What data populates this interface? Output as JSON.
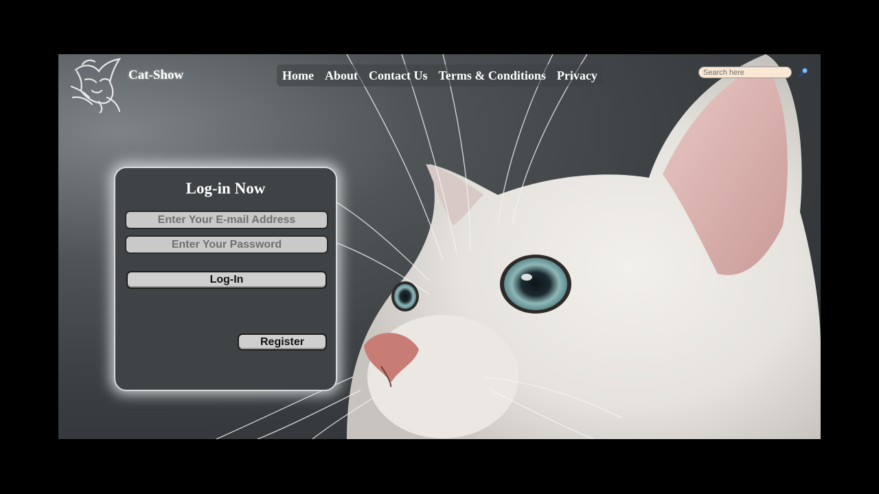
{
  "header": {
    "brand": "Cat-Show",
    "nav": [
      "Home",
      "About",
      "Contact Us",
      "Terms & Conditions",
      "Privacy"
    ],
    "search_placeholder": "Search here"
  },
  "login": {
    "title": "Log-in Now",
    "email_placeholder": "Enter Your E-mail Address",
    "password_placeholder": "Enter Your Password",
    "login_label": "Log-In",
    "register_label": "Register"
  },
  "icons": {
    "logo": "cat-head-logo-icon",
    "search": "magnifier-icon"
  },
  "colors": {
    "page_bg": "#000000",
    "panel_bg": "#3f4345",
    "search_bg": "#fbe8d4",
    "button_bg": "#cfcfcf"
  }
}
